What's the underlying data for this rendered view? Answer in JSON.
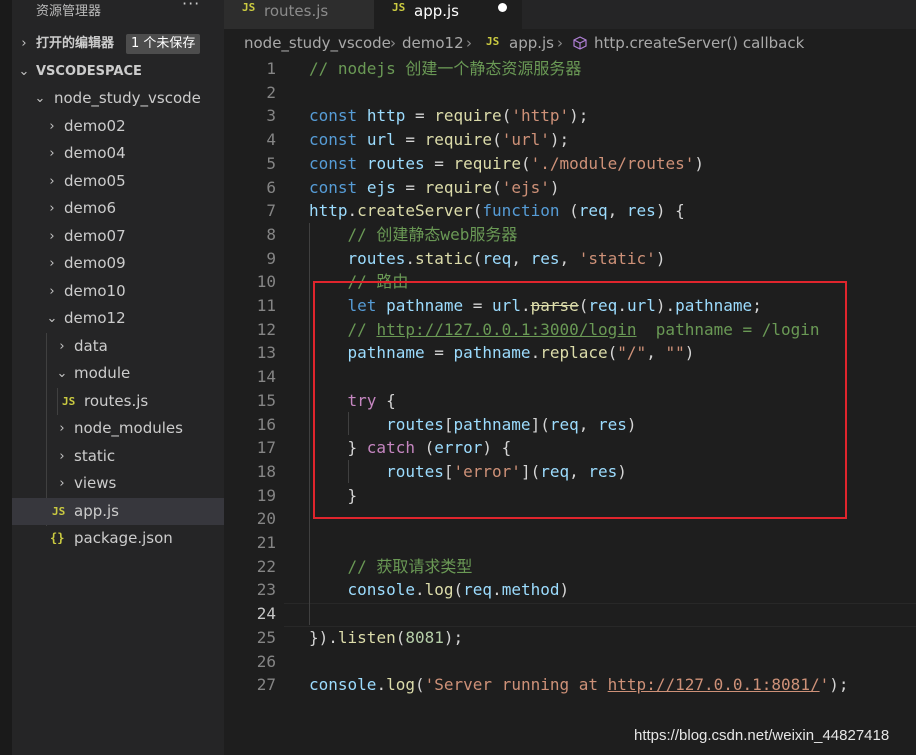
{
  "colors": {
    "accent_red_box": "#e0252d",
    "js_icon": "#cbcb41"
  },
  "sidebar": {
    "title": "资源管理器",
    "more": "···",
    "open_editors": {
      "label": "打开的编辑器",
      "badge": "1 个未保存"
    },
    "workspace": "VSCODESPACE",
    "tree": [
      {
        "label": "node_study_vscode",
        "chevron": "⌄"
      },
      {
        "label": "demo02",
        "chevron": "›"
      },
      {
        "label": "demo04",
        "chevron": "›"
      },
      {
        "label": "demo05",
        "chevron": "›"
      },
      {
        "label": "demo6",
        "chevron": "›"
      },
      {
        "label": "demo07",
        "chevron": "›"
      },
      {
        "label": "demo09",
        "chevron": "›"
      },
      {
        "label": "demo10",
        "chevron": "›"
      },
      {
        "label": "demo12",
        "chevron": "⌄"
      },
      {
        "label": "data",
        "chevron": "›"
      },
      {
        "label": "module",
        "chevron": "⌄"
      },
      {
        "label": "routes.js",
        "icon": "JS"
      },
      {
        "label": "node_modules",
        "chevron": "›"
      },
      {
        "label": "static",
        "chevron": "›"
      },
      {
        "label": "views",
        "chevron": "›"
      },
      {
        "label": "app.js",
        "icon": "JS"
      },
      {
        "label": "package.json",
        "icon": "{}"
      }
    ]
  },
  "tabs": [
    {
      "label": "routes.js",
      "icon": "JS"
    },
    {
      "label": "app.js",
      "icon": "JS"
    }
  ],
  "breadcrumb": {
    "items": [
      "node_study_vscode",
      "demo12",
      "app.js",
      "http.createServer() callback"
    ],
    "js_icon": "JS",
    "sep": "›"
  },
  "editor": {
    "line_numbers": [
      "1",
      "2",
      "3",
      "4",
      "5",
      "6",
      "7",
      "8",
      "9",
      "10",
      "11",
      "12",
      "13",
      "14",
      "15",
      "16",
      "17",
      "18",
      "19",
      "20",
      "21",
      "22",
      "23",
      "24",
      "25",
      "26",
      "27"
    ],
    "current_line": "24",
    "tokens": {
      "l1": "// nodejs 创建一个静态资源服务器",
      "kw_const": "const",
      "http": "http",
      "url": "url",
      "routes": "routes",
      "ejs": "ejs",
      "eq": " = ",
      "require": "require",
      "s_http": "'http'",
      "s_url": "'url'",
      "s_routes": "'./module/routes'",
      "s_ejs": "'ejs'",
      "createServer": "createServer",
      "function": "function",
      "req": "req",
      "res": "res",
      "c8": "// 创建静态web服务器",
      "static": "static",
      "s_static": "'static'",
      "c10": "// 路由",
      "let": "let",
      "pathname": "pathname",
      "parse": "parse",
      "c12a": "// ",
      "c12link": "http://127.0.0.1:3000/login",
      "c12b": "  pathname = /login",
      "replace": "replace",
      "s_slash": "\"/\"",
      "s_empty": "\"\"",
      "try": "try",
      "catch": "catch",
      "error": "error",
      "s_error": "'error'",
      "c22": "// 获取请求类型",
      "console": "console",
      "log": "log",
      "method": "method",
      "listen": "listen",
      "port": "8081",
      "s_srv_a": "'Server running at ",
      "s_srv_link": "http://127.0.0.1:8081/",
      "s_srv_b": "'"
    }
  },
  "watermark": "https://blog.csdn.net/weixin_44827418"
}
